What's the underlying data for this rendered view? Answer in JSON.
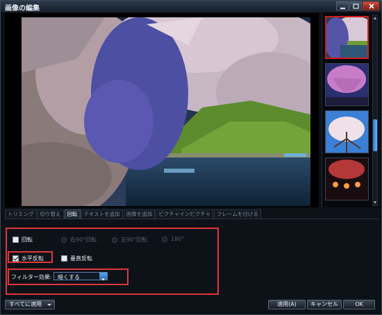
{
  "window": {
    "title": "画像の編集"
  },
  "thumbnails": [
    {
      "name": "river-cherry-blossom",
      "selected": true
    },
    {
      "name": "weeping-cherry-night",
      "selected": false
    },
    {
      "name": "cherry-blue-sky",
      "selected": false
    },
    {
      "name": "night-lanterns",
      "selected": false
    }
  ],
  "tabs": [
    {
      "label": "トリミング",
      "active": false
    },
    {
      "label": "切り替え",
      "active": false
    },
    {
      "label": "回転",
      "active": true
    },
    {
      "label": "テキストを追加",
      "active": false
    },
    {
      "label": "画像を追加",
      "active": false
    },
    {
      "label": "ピクチャインピクチャ",
      "active": false
    },
    {
      "label": "フレームを付ける",
      "active": false
    }
  ],
  "rotate": {
    "enable_label": "回転",
    "enable_checked": false,
    "options": [
      "右90°回転",
      "左90°回転",
      "180°"
    ]
  },
  "flip": {
    "horizontal_label": "水平反転",
    "horizontal_checked": true,
    "vertical_label": "垂直反転",
    "vertical_checked": false
  },
  "filter": {
    "label": "フィルター効果:",
    "value": "暗くする"
  },
  "buttons": {
    "apply_all": "すべてに適用",
    "apply": "適用(A)",
    "cancel": "キャンセル",
    "ok": "OK"
  },
  "colors": {
    "highlight": "#e0363b",
    "accent": "#3a8be0",
    "selected_thumbnail": "#d41c1c"
  }
}
